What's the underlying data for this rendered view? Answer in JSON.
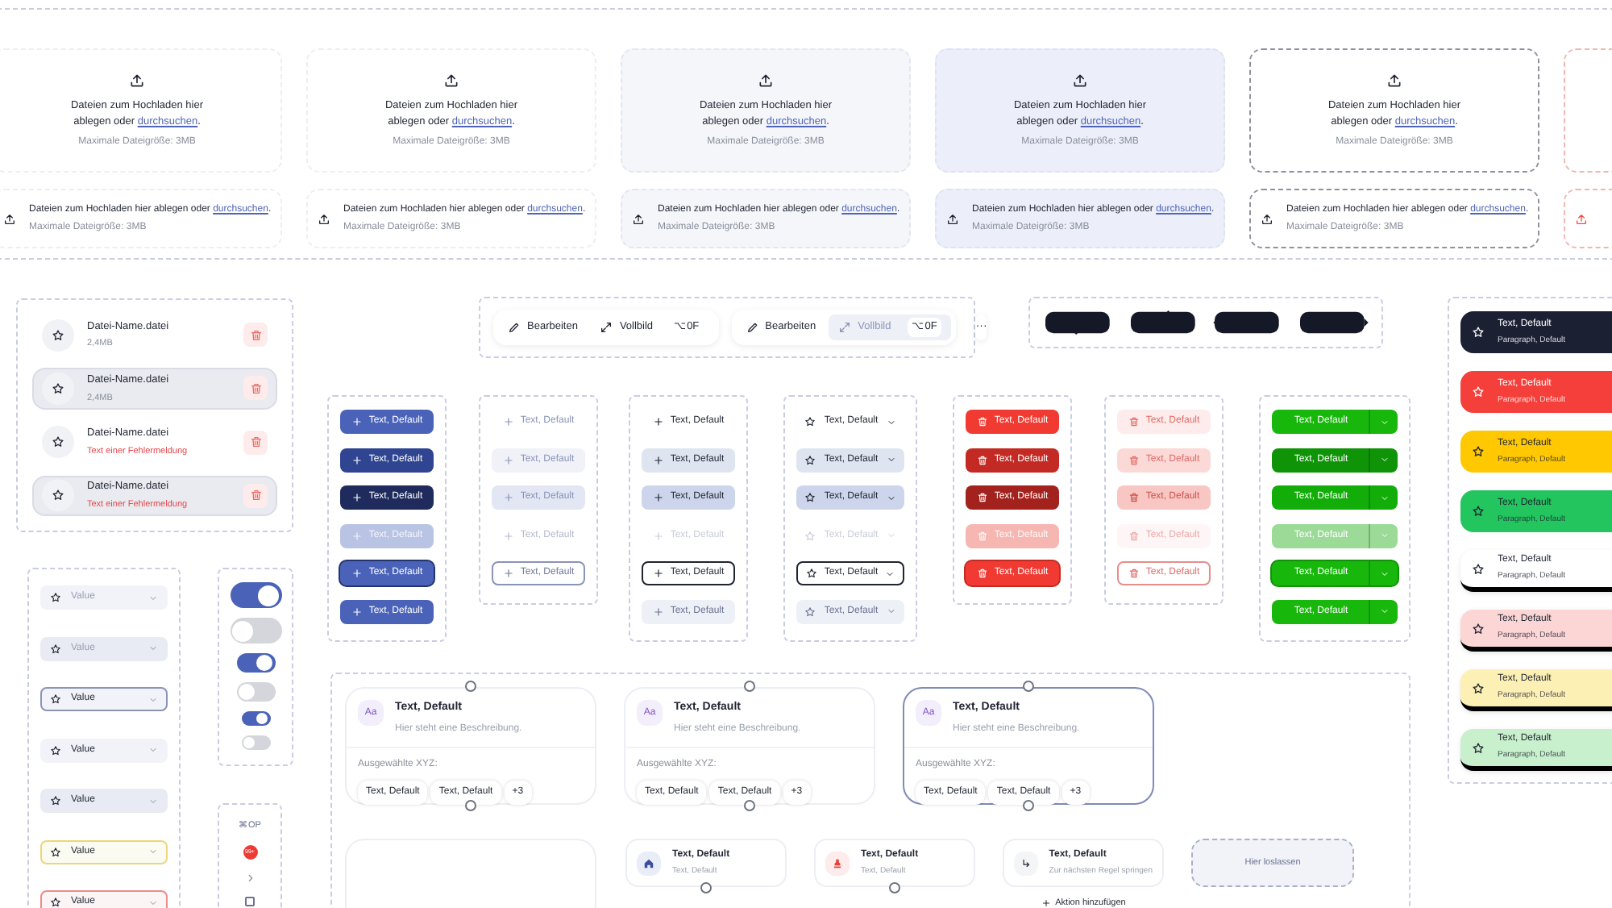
{
  "upload": {
    "columns": [
      {
        "kind": "default",
        "large": {
          "prompt": "Dateien zum Hochladen hier ablegen oder",
          "link": "durchsuchen",
          "end": ".",
          "hint": "Maximale Dateigröße: 3MB"
        },
        "compact": {
          "prompt": "Dateien zum Hochladen hier ablegen oder",
          "link": "durchsuchen",
          "end": ".",
          "hint": "Maximale Dateigröße: 3MB"
        }
      },
      {
        "kind": "default",
        "large": {
          "prompt": "Dateien zum Hochladen hier ablegen oder",
          "link": "durchsuchen",
          "end": ".",
          "hint": "Maximale Dateigröße: 3MB"
        },
        "compact": {
          "prompt": "Dateien zum Hochladen hier ablegen oder",
          "link": "durchsuchen",
          "end": ".",
          "hint": "Maximale Dateigröße: 3MB"
        }
      },
      {
        "kind": "hover",
        "large": {
          "prompt": "Dateien zum Hochladen hier ablegen oder",
          "link": "durchsuchen",
          "end": ".",
          "hint": "Maximale Dateigröße: 3MB"
        },
        "compact": {
          "prompt": "Dateien zum Hochladen hier ablegen oder",
          "link": "durchsuchen",
          "end": ".",
          "hint": "Maximale Dateigröße: 3MB"
        }
      },
      {
        "kind": "active",
        "large": {
          "prompt": "Dateien zum Hochladen hier ablegen oder",
          "link": "durchsuchen",
          "end": ".",
          "hint": "Maximale Dateigröße: 3MB"
        },
        "compact": {
          "prompt": "Dateien zum Hochladen hier ablegen oder",
          "link": "durchsuchen",
          "end": ".",
          "hint": "Maximale Dateigröße: 3MB"
        }
      },
      {
        "kind": "focus",
        "large": {
          "prompt": "Dateien zum Hochladen hier ablegen oder",
          "link": "durchsuchen",
          "end": ".",
          "hint": "Maximale Dateigröße: 3MB"
        },
        "compact": {
          "prompt": "Dateien zum Hochladen hier ablegen oder",
          "link": "durchsuchen",
          "end": ".",
          "hint": "Maximale Dateigröße: 3MB"
        }
      },
      {
        "kind": "error"
      }
    ]
  },
  "files": [
    {
      "name": "Datei-Name.datei",
      "detail": "2,4MB",
      "kind": "size",
      "hover": false
    },
    {
      "name": "Datei-Name.datei",
      "detail": "2,4MB",
      "kind": "size",
      "hover": true
    },
    {
      "name": "Datei-Name.datei",
      "detail": "Text einer Fehlermeldung",
      "kind": "error",
      "hover": false
    },
    {
      "name": "Datei-Name.datei",
      "detail": "Text einer Fehlermeldung",
      "kind": "error",
      "hover": true
    }
  ],
  "toolbars": [
    {
      "items": [
        {
          "label": "Bearbeiten",
          "kind": "edit",
          "selected": false
        },
        {
          "label": "Vollbild",
          "kind": "fullscreen",
          "shortcut": "⌥0F",
          "selected": false
        }
      ]
    },
    {
      "items": [
        {
          "label": "Bearbeiten",
          "kind": "edit",
          "selected": false
        },
        {
          "label": "Vollbild",
          "kind": "fullscreen",
          "shortcut": "⌥0F",
          "selected": true
        }
      ]
    }
  ],
  "more_button": "···",
  "tooltips": [
    {
      "kind": "bottom"
    },
    {
      "kind": "top"
    },
    {
      "kind": "left"
    },
    {
      "kind": "right"
    }
  ],
  "button_groups": [
    {
      "kind": "primary",
      "buttons": [
        {
          "label": "Text, Default",
          "kind": "default"
        },
        {
          "label": "Text, Default",
          "kind": "hover"
        },
        {
          "label": "Text, Default",
          "kind": "pressed"
        },
        {
          "label": "Text, Default",
          "kind": "disabled"
        },
        {
          "label": "Text, Default",
          "kind": "focus"
        },
        {
          "label": "Text, Default",
          "kind": "default"
        }
      ]
    },
    {
      "kind": "ghost",
      "buttons": [
        {
          "label": "Text, Default",
          "kind": "default"
        },
        {
          "label": "Text, Default",
          "kind": "hover"
        },
        {
          "label": "Text, Default",
          "kind": "pressed"
        },
        {
          "label": "Text, Default",
          "kind": "disabled"
        },
        {
          "label": "Text, Default",
          "kind": "focus"
        }
      ]
    },
    {
      "kind": "secondary",
      "buttons": [
        {
          "label": "Text, Default",
          "kind": "default"
        },
        {
          "label": "Text, Default",
          "kind": "hover"
        },
        {
          "label": "Text, Default",
          "kind": "pressed"
        },
        {
          "label": "Text, Default",
          "kind": "disabled"
        },
        {
          "label": "Text, Default",
          "kind": "focus"
        },
        {
          "label": "Text, Default",
          "kind": "muted"
        }
      ]
    },
    {
      "kind": "dropdown",
      "buttons": [
        {
          "label": "Text, Default",
          "kind": "default"
        },
        {
          "label": "Text, Default",
          "kind": "hover"
        },
        {
          "label": "Text, Default",
          "kind": "pressed"
        },
        {
          "label": "Text, Default",
          "kind": "disabled"
        },
        {
          "label": "Text, Default",
          "kind": "focus"
        },
        {
          "label": "Text, Default",
          "kind": "muted"
        }
      ]
    },
    {
      "kind": "danger",
      "buttons": [
        {
          "label": "Text, Default",
          "kind": "default"
        },
        {
          "label": "Text, Default",
          "kind": "hover"
        },
        {
          "label": "Text, Default",
          "kind": "pressed"
        },
        {
          "label": "Text, Default",
          "kind": "disabled"
        },
        {
          "label": "Text, Default",
          "kind": "focus"
        }
      ]
    },
    {
      "kind": "danger-soft",
      "buttons": [
        {
          "label": "Text, Default",
          "kind": "default"
        },
        {
          "label": "Text, Default",
          "kind": "hover"
        },
        {
          "label": "Text, Default",
          "kind": "pressed"
        },
        {
          "label": "Text, Default",
          "kind": "disabled"
        },
        {
          "label": "Text, Default",
          "kind": "focus"
        }
      ]
    },
    {
      "kind": "split",
      "buttons": [
        {
          "label": "Text, Default",
          "kind": "default"
        },
        {
          "label": "Text, Default",
          "kind": "hover"
        },
        {
          "label": "Text, Default",
          "kind": "pressed"
        },
        {
          "label": "Text, Default",
          "kind": "disabled"
        },
        {
          "label": "Text, Default",
          "kind": "focus"
        },
        {
          "label": "Text, Default",
          "kind": "default"
        }
      ]
    }
  ],
  "notifications": [
    {
      "title": "Text, Default",
      "text": "Paragraph, Default",
      "color": "#1c2033",
      "elevated": false
    },
    {
      "title": "Text, Default",
      "text": "Paragraph, Default",
      "color": "#f43f3a",
      "elevated": false
    },
    {
      "title": "Text, Default",
      "text": "Paragraph, Default",
      "color": "#ffc800",
      "elevated": false
    },
    {
      "title": "Text, Default",
      "text": "Paragraph, Default",
      "color": "#22c55e",
      "elevated": false
    },
    {
      "title": "Text, Default",
      "text": "Paragraph, Default",
      "color": "#ffffff",
      "elevated": true
    },
    {
      "title": "Text, Default",
      "text": "Paragraph, Default",
      "color": "#fcd5d5",
      "elevated": true
    },
    {
      "title": "Text, Default",
      "text": "Paragraph, Default",
      "color": "#fdf0b5",
      "elevated": true
    },
    {
      "title": "Text, Default",
      "text": "Paragraph, Default",
      "color": "#c8f0cc",
      "elevated": true
    }
  ],
  "selects": [
    {
      "placeholder": "Value",
      "kind": "empty"
    },
    {
      "placeholder": "Value",
      "kind": "empty-hover"
    },
    {
      "value": "Value",
      "kind": "focus"
    },
    {
      "value": "Value",
      "kind": "filled"
    },
    {
      "value": "Value",
      "kind": "filled-hover"
    },
    {
      "value": "Value",
      "kind": "warning"
    },
    {
      "value": "Value",
      "kind": "error"
    }
  ],
  "toggles": [
    {
      "kind": "lg",
      "on": true
    },
    {
      "kind": "lg",
      "on": false
    },
    {
      "kind": "md",
      "on": true
    },
    {
      "kind": "md",
      "on": false
    },
    {
      "kind": "sm",
      "on": true
    },
    {
      "kind": "sm",
      "on": false
    }
  ],
  "misc": {
    "shortcut": "⌘OP",
    "badge": "99+",
    "checkbox": {
      "checked": false
    }
  },
  "nodes": [
    {
      "badge": "Aa",
      "title": "Text, Default",
      "description": "Hier steht eine Beschreibung.",
      "section_label": "Ausgewählte XYZ:",
      "chips": [
        "Text, Default",
        "Text, Default",
        "+3"
      ],
      "selected": false
    },
    {
      "badge": "Aa",
      "title": "Text, Default",
      "description": "Hier steht eine Beschreibung.",
      "section_label": "Ausgewählte XYZ:",
      "chips": [
        "Text, Default",
        "Text, Default",
        "+3"
      ],
      "selected": false
    },
    {
      "badge": "Aa",
      "title": "Text, Default",
      "description": "Hier steht eine Beschreibung.",
      "section_label": "Ausgewählte XYZ:",
      "chips": [
        "Text, Default",
        "Text, Default",
        "+3"
      ],
      "selected": true
    }
  ],
  "action_nodes": [
    {
      "kind": "home",
      "title": "Text, Default",
      "subtitle": "Text, Default"
    },
    {
      "kind": "stamp",
      "title": "Text, Default",
      "subtitle": "Text, Default"
    },
    {
      "kind": "jump",
      "title": "Text, Default",
      "subtitle": "Zur nächsten Regel springen",
      "add_action": "Aktion hinzufügen"
    }
  ],
  "drop_zone": "Hier loslassen"
}
